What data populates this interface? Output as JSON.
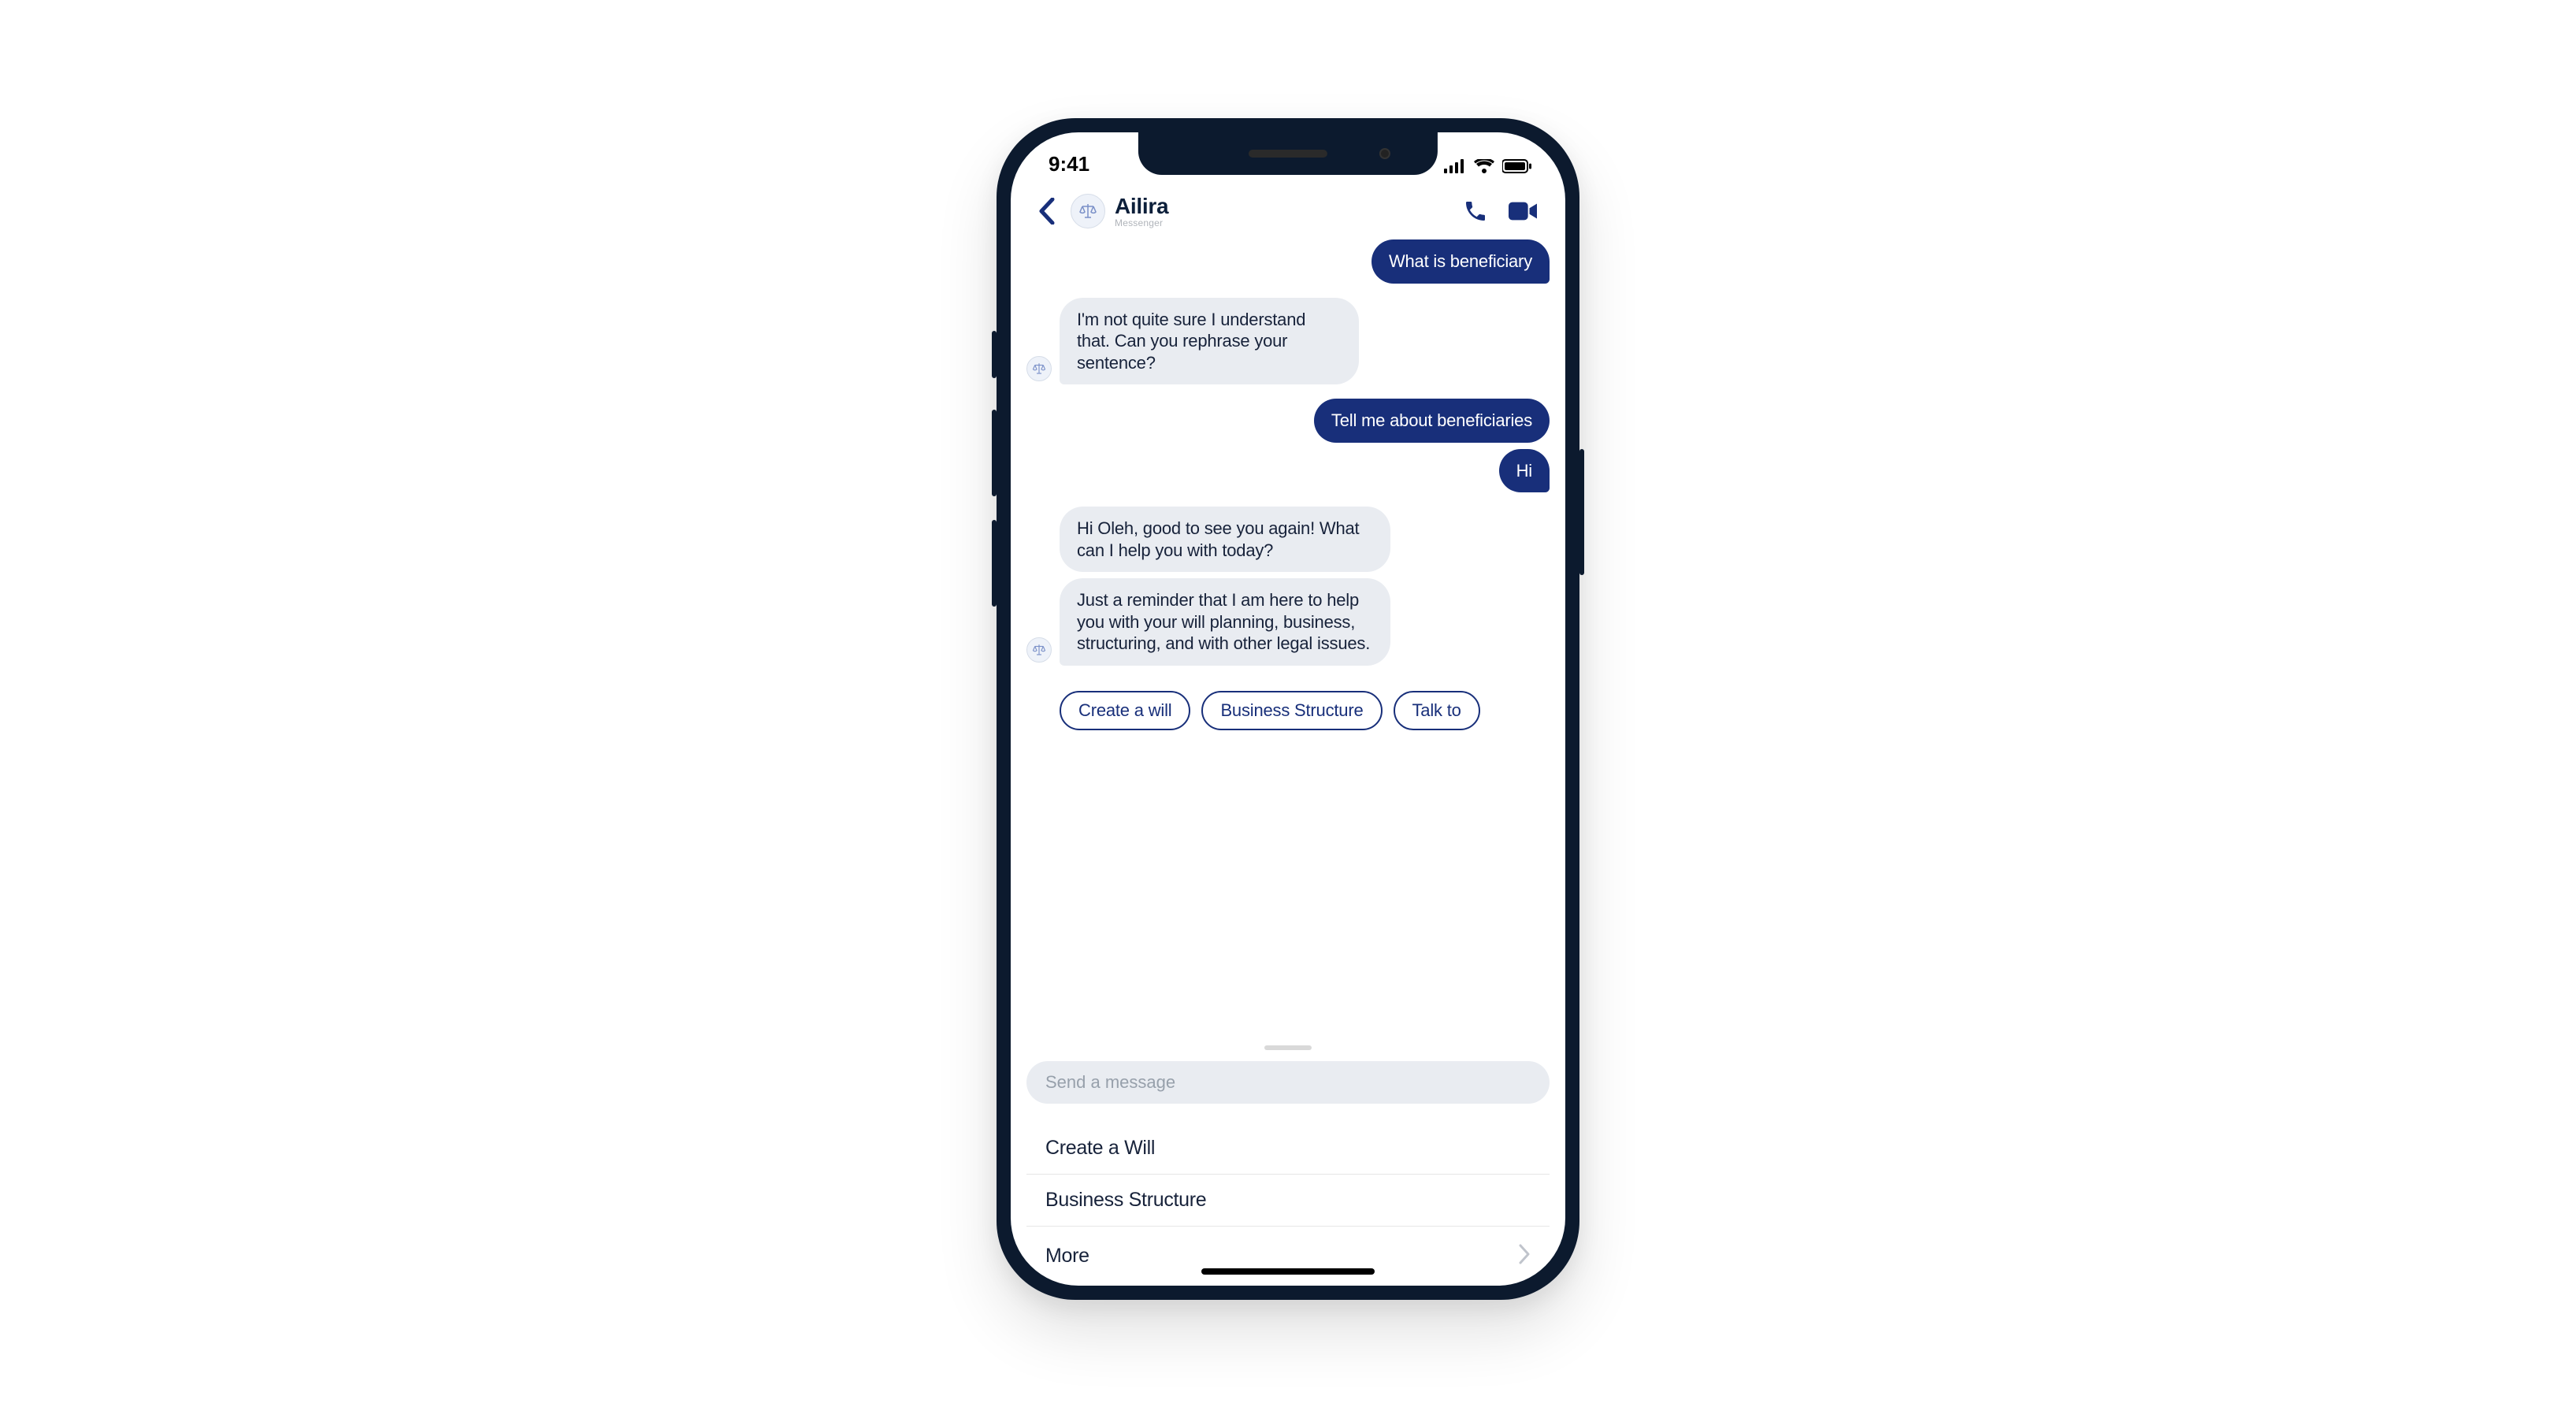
{
  "status": {
    "time": "9:41"
  },
  "header": {
    "title": "Ailira",
    "subtitle": "Messenger"
  },
  "messages": {
    "m1": "What is beneficiary",
    "m2": "I'm not quite sure I understand that. Can you rephrase your sentence?",
    "m3": "Tell me about beneficiaries",
    "m4": "Hi",
    "m5": "Hi Oleh, good to see you again! What can I help you with today?",
    "m6": "Just a reminder that I am here to help you with your will planning, business, structuring, and with other legal issues."
  },
  "chips": {
    "c1": "Create a will",
    "c2": "Business Structure",
    "c3": "Talk to"
  },
  "input": {
    "placeholder": "Send a message"
  },
  "menu": {
    "i1": "Create a Will",
    "i2": "Business Structure",
    "i3": "More"
  },
  "colors": {
    "brand": "#182f7a"
  }
}
